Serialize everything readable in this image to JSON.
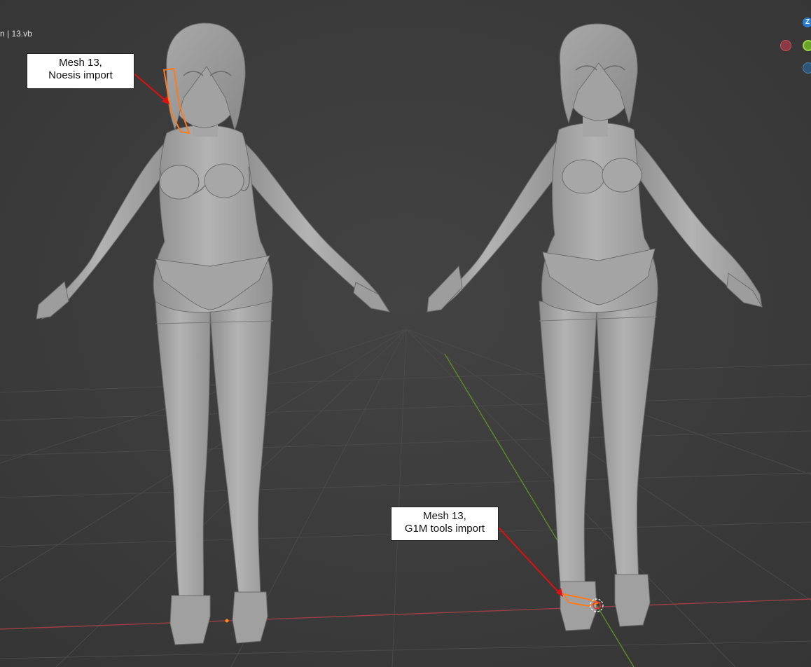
{
  "viewport": {
    "object_label": "n | 13.vb"
  },
  "callouts": {
    "noesis": {
      "line1": "Mesh 13,",
      "line2": "Noesis import"
    },
    "g1m": {
      "line1": "Mesh 13,",
      "line2": "G1M tools import"
    }
  },
  "gizmo": {
    "z_label": "Z"
  },
  "colors": {
    "background": "#3d3d3d",
    "x_axis": "#b8474f",
    "y_axis": "#6aa329",
    "selection_outline": "#ff7b1a",
    "arrow": "#e01010"
  }
}
